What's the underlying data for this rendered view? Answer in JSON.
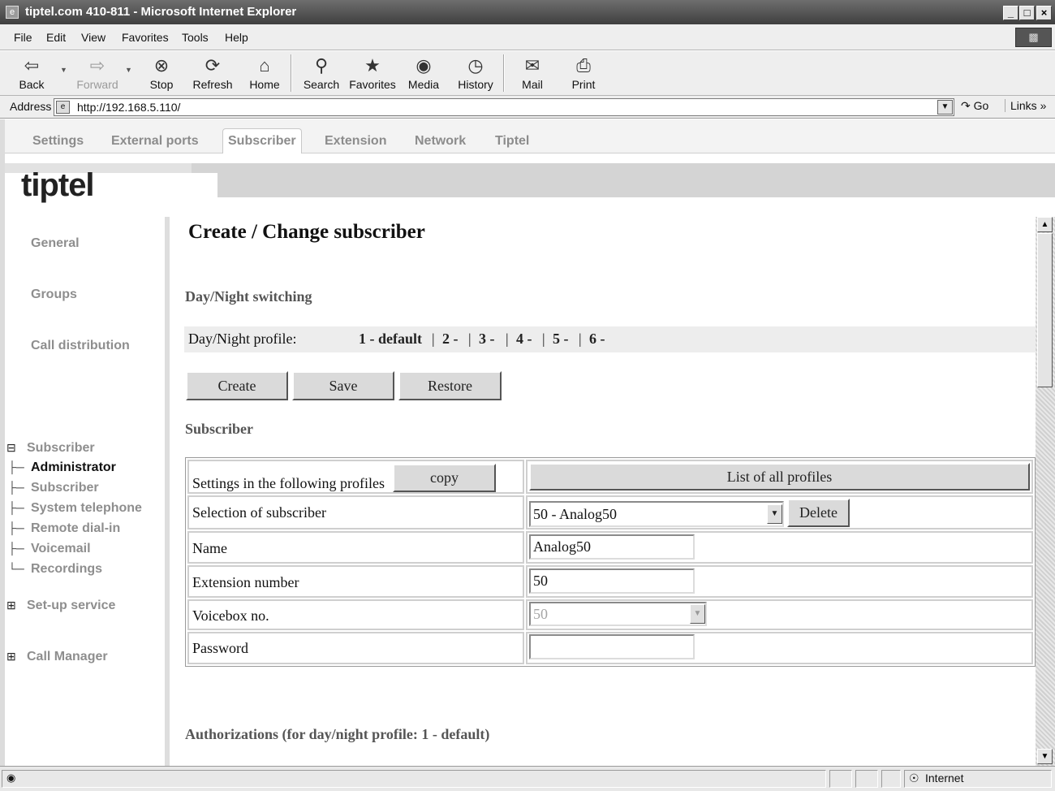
{
  "window": {
    "title": "tiptel.com 410-811 - Microsoft Internet Explorer",
    "icon": "ie-page-icon",
    "controls": [
      "_",
      "Ø",
      "×"
    ]
  },
  "menu": [
    "File",
    "Edit",
    "View",
    "Favorites",
    "Tools",
    "Help"
  ],
  "toolbar": {
    "back": "Back",
    "forward": "Forward",
    "stop": "Stop",
    "refresh": "Refresh",
    "home": "Home",
    "search": "Search",
    "favorites": "Favorites",
    "media": "Media",
    "history": "History",
    "mail": "Mail",
    "print": "Print"
  },
  "address": {
    "label": "Address",
    "url": "http://192.168.5.110/",
    "go": "Go",
    "links": "Links"
  },
  "nav_tabs": [
    {
      "label": "Settings",
      "active": false
    },
    {
      "label": "External ports",
      "active": false
    },
    {
      "label": "Subscriber",
      "active": true
    },
    {
      "label": "Extension",
      "active": false
    },
    {
      "label": "Network",
      "active": false
    },
    {
      "label": "Tiptel",
      "active": false
    }
  ],
  "logo": "tiptel",
  "sidebar": {
    "general": "General",
    "groups": "Groups",
    "call_distribution": "Call distribution",
    "subscriber_group": "Subscriber",
    "subscriber_children": [
      "Administrator",
      "Subscriber",
      "System telephone",
      "Remote dial-in",
      "Voicemail",
      "Recordings"
    ],
    "setup_service": "Set-up service",
    "call_manager": "Call Manager"
  },
  "main": {
    "title": "Create / Change subscriber",
    "daynight_heading": "Day/Night switching",
    "profile_label": "Day/Night profile:",
    "profiles": [
      "1 - default",
      "2 -",
      "3 -",
      "4 -",
      "5 -",
      "6 -"
    ],
    "buttons": {
      "create": "Create",
      "save": "Save",
      "restore": "Restore"
    },
    "subscriber_heading": "Subscriber",
    "table": {
      "copy_label": "Settings in the following profiles",
      "copy_button": "copy",
      "list_profiles_button": "List of all profiles",
      "selection_label": "Selection of subscriber",
      "selection_value": "50 - Analog50",
      "delete_button": "Delete",
      "name_label": "Name",
      "name_value": "Analog50",
      "extension_label": "Extension number",
      "extension_value": "50",
      "voicebox_label": "Voicebox no.",
      "voicebox_value": "50",
      "password_label": "Password",
      "password_value": ""
    },
    "authorizations_heading": "Authorizations (for day/night profile: 1 - default)"
  },
  "status": {
    "zone": "Internet"
  },
  "colors": {
    "titlebar": "#4a4a4a",
    "chrome": "#eeeeee",
    "sidebar_text": "#8e8e8e",
    "button_face": "#dadada"
  }
}
